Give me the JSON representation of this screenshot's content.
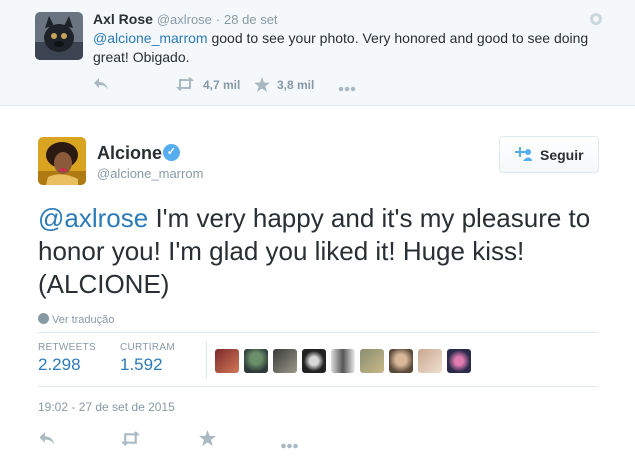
{
  "parent_tweet": {
    "name": "Axl Rose",
    "handle": "@axlrose",
    "separator": "·",
    "time": "28 de set",
    "mention": "@alcione_marrom",
    "text": " good to see your photo. Very honored and good to see doing great! Obigado.",
    "retweets": "4,7 mil",
    "favorites": "3,8 mil"
  },
  "main_tweet": {
    "name": "Alcione",
    "verified_mark": "✓",
    "handle": "@alcione_marrom",
    "follow_label": "Seguir",
    "mention": "@axlrose",
    "text": " I'm very happy and it's my pleasure to honor you! I'm glad you liked it! Huge kiss! (ALCIONE)",
    "translate_label": "Ver tradução",
    "retweets_label": "RETWEETS",
    "retweets_value": "2.298",
    "likes_label": "CURTIRAM",
    "likes_value": "1.592",
    "date": "19:02 - 27 de set de 2015"
  },
  "colors": {
    "link": "#2b7bb9",
    "muted": "#8899a6",
    "verified": "#55acee",
    "border": "#e1e8ed",
    "parent_bg": "#f5f8fa"
  },
  "icons": [
    "reply-icon",
    "retweet-icon",
    "favorite-icon",
    "more-icon",
    "globe-icon",
    "verified-badge-icon",
    "follow-user-icon"
  ]
}
